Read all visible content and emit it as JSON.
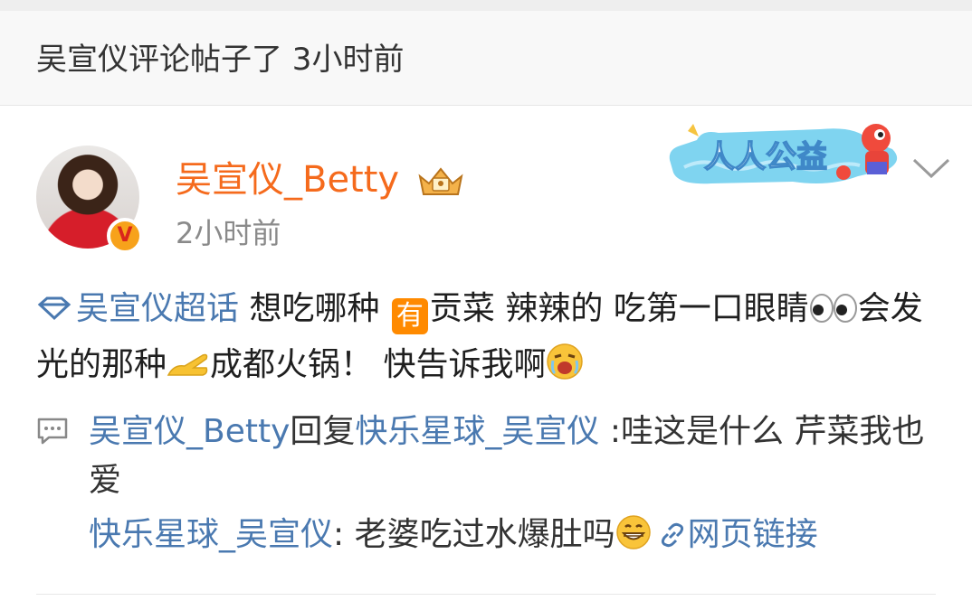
{
  "notice": {
    "text": "吴宣仪评论帖子了 3小时前"
  },
  "post": {
    "username": "吴宣仪_Betty",
    "time": "2小时前",
    "verified_mark": "V",
    "banner_text": "人人公益",
    "body": {
      "topic": "吴宣仪超话",
      "part1": " 想吃哪种 ",
      "you_badge": "有",
      "part2": "贡菜 辣辣的 吃第一口眼睛",
      "part3": "会发光的那种",
      "part4": "成都火锅！ 快告诉我啊"
    },
    "reply1": {
      "author": "吴宣仪_Betty",
      "action": "回复",
      "target": "快乐星球_吴宣仪",
      "text": " :哇这是什么 芹菜我也爱"
    },
    "reply2": {
      "author": "快乐星球_吴宣仪",
      "text": ": 老婆吃过水爆肚吗",
      "link_label": "网页链接"
    }
  },
  "colors": {
    "username": "#f56a1c",
    "link_blue": "#4a79b0",
    "muted": "#8a8a8a"
  }
}
